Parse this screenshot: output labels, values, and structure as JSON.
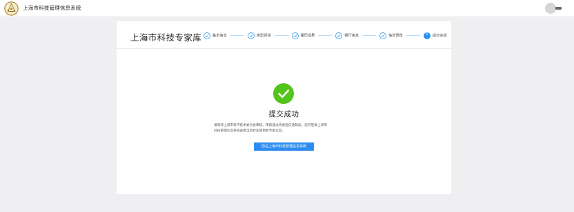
{
  "header": {
    "title": "上海市科技管理信息系统",
    "logo_icon": "seal-logo-icon"
  },
  "panel": {
    "brand": "上海市科技专家库",
    "steps": [
      {
        "label": "基本信息",
        "state": "done"
      },
      {
        "label": "类型领域",
        "state": "done"
      },
      {
        "label": "履历成果",
        "state": "done"
      },
      {
        "label": "银行信息",
        "state": "done"
      },
      {
        "label": "信息预览",
        "state": "done"
      },
      {
        "label": "提交完成",
        "state": "current",
        "number": "6"
      }
    ]
  },
  "result": {
    "icon": "check-circle-icon",
    "title": "提交成功",
    "desc_line1": "请等待上海市科学技术委员会审核，审核通过将发短信通知您。您可登录上海市",
    "desc_line2": "科技管理信息系统查看当前状态或更新专家信息。",
    "button_label": "前往上海市科技管理信息系统"
  },
  "colors": {
    "accent": "#2d8cf0",
    "success": "#52c41a",
    "background": "#efeff2"
  }
}
